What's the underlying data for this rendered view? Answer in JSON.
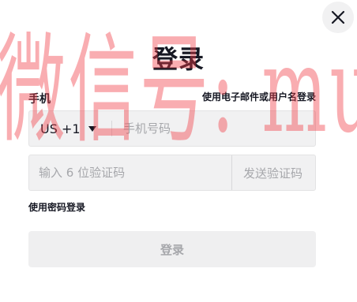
{
  "dialog": {
    "title": "登录",
    "close_icon": "close-icon"
  },
  "phone": {
    "label": "手机",
    "alt_login_link": "使用电子邮件或用户名登录",
    "country_code": "US +1",
    "placeholder": "手机号码",
    "value": ""
  },
  "verification": {
    "placeholder": "输入 6 位验证码",
    "value": "",
    "send_code_label": "发送验证码"
  },
  "password_login_link": "使用密码登录",
  "submit_label": "登录",
  "watermark": "微信号: muhuanidc",
  "colors": {
    "text": "#161823",
    "input_bg": "#f1f1f2",
    "disabled_text": "#a6a7ab",
    "watermark": "#f03c46"
  }
}
